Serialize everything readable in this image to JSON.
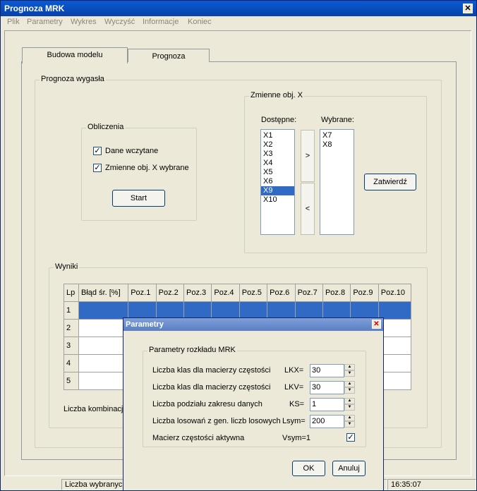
{
  "window": {
    "title": "Prognoza MRK"
  },
  "menu": [
    "Plik",
    "Parametry",
    "Wykres",
    "Wyczyść",
    "Informacje",
    "Koniec"
  ],
  "tabs": [
    "Budowa modelu",
    "Prognoza"
  ],
  "main_group": {
    "label": "Prognoza wygasła"
  },
  "obliczenia": {
    "label": "Obliczenia",
    "check1": "Dane wczytane",
    "check2": "Zmienne obj. X wybrane",
    "check1_checked": true,
    "check2_checked": true,
    "start_label": "Start"
  },
  "zmienne": {
    "label": "Zmienne obj. X",
    "available_label": "Dostępne:",
    "selected_label": "Wybrane:",
    "available": [
      "X1",
      "X2",
      "X3",
      "X4",
      "X5",
      "X6",
      "X9",
      "X10"
    ],
    "available_selected": "X9",
    "selected": [
      "X7",
      "X8"
    ],
    "add_btn": ">",
    "remove_btn": "<",
    "confirm_label": "Zatwierdź"
  },
  "wyniki": {
    "label": "Wyniki",
    "headers": [
      "Lp",
      "Błąd śr. [%]",
      "Poz.1",
      "Poz.2",
      "Poz.3",
      "Poz.4",
      "Poz.5",
      "Poz.6",
      "Poz.7",
      "Poz.8",
      "Poz.9",
      "Poz.10"
    ],
    "rows": [
      "1",
      "2",
      "3",
      "4",
      "5"
    ],
    "combinations_label": "Liczba kombinacji"
  },
  "status": {
    "left": "Liczba wybranych",
    "time": "16:35:07"
  },
  "dialog": {
    "title": "Parametry",
    "group_label": "Parametry rozkładu MRK",
    "rows": [
      {
        "label": "Liczba klas dla macierzy częstości",
        "key": "LKX=",
        "value": "30"
      },
      {
        "label": "Liczba klas dla macierzy częstości",
        "key": "LKV=",
        "value": "30"
      },
      {
        "label": "Liczba podziału zakresu danych",
        "key": "KS=",
        "value": "1"
      },
      {
        "label": "Liczba losowań z gen. liczb losowych",
        "key": "Lsym=",
        "value": "200"
      }
    ],
    "active_label": "Macierz częstości aktywna",
    "active_key": "Vsym=1",
    "active_checked": true,
    "ok_label": "OK",
    "cancel_label": "Anuluj"
  },
  "icons": {
    "close": "close-icon",
    "check": "check-icon",
    "spin_up": "spin-up-icon",
    "spin_down": "spin-down-icon"
  },
  "colors": {
    "title_bar": "#0a5ad4",
    "selection": "#316ac5",
    "window_bg": "#ece9d8"
  }
}
